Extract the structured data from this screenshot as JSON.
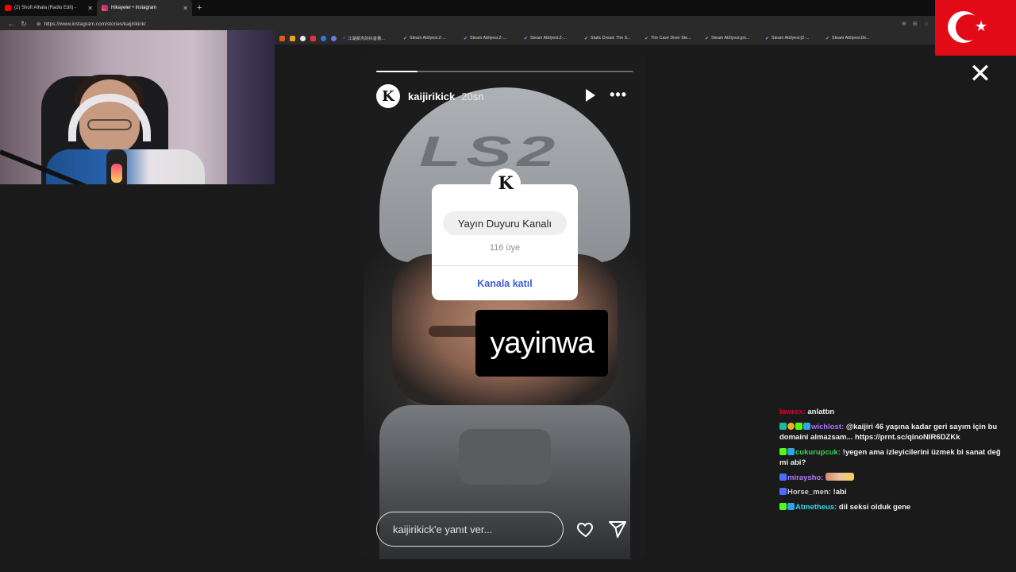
{
  "browser": {
    "tabs": [
      {
        "label": "(2) Shoft Alhala (Radio Edit) -",
        "active": false
      },
      {
        "label": "Hikayeler • Instagram",
        "active": true
      }
    ],
    "url": "https://www.instagram.com/stories/kaijirikick/",
    "bookmarks": [
      "江湖豪杰的抖音着...",
      "Steam Atölyesi:Z-...",
      "Steam Atölyesi:Z-...",
      "Steam Atölyesi:Z-...",
      "Static Dread: The S...",
      "The Cave Diver Ste...",
      "Steam Atölyesi:gm...",
      "Steam Atölyesi:[Z-...",
      "Steam Atölyesi:De..."
    ]
  },
  "story": {
    "username": "kaijirikick",
    "time": "20sn",
    "avatar_glyph": "K",
    "progress": 0.16,
    "helmet_text": "LS2",
    "channel_card": {
      "title": "Yayın Duyuru Kanalı",
      "members": "116 üye",
      "join": "Kanala katıl"
    },
    "sticker_text": "yayinwa",
    "reply_placeholder": "kaijirikick'e yanıt ver..."
  },
  "chat": {
    "messages": [
      {
        "user": "lawrex",
        "color": "#e0002b",
        "text": "anlattın"
      },
      {
        "user": "wichlost",
        "color": "#a970ff",
        "text": "@kaijiri 46 yaşına kadar geri sayım için bu domaini almazsam... https://prnt.sc/qinoNIR6DZKk"
      },
      {
        "user": "cukurupcuk",
        "color": "#39d353",
        "text": "!yegen ama izleyicilerini üzmek bi sanat değ mi abi?"
      },
      {
        "user": "miraysho",
        "color": "#b07cff",
        "text": ""
      },
      {
        "user": "Horse_men",
        "color": "#cfcfcf",
        "text": "!abi"
      },
      {
        "user": "Atmetheus",
        "color": "#3ad6e8",
        "text": "dil seksi olduk gene"
      }
    ]
  },
  "colors": {
    "flag_red": "#e30a17",
    "join_blue": "#3b5bdb"
  },
  "icons": [
    "close-icon",
    "play-icon",
    "more-icon",
    "heart-icon",
    "send-icon"
  ]
}
